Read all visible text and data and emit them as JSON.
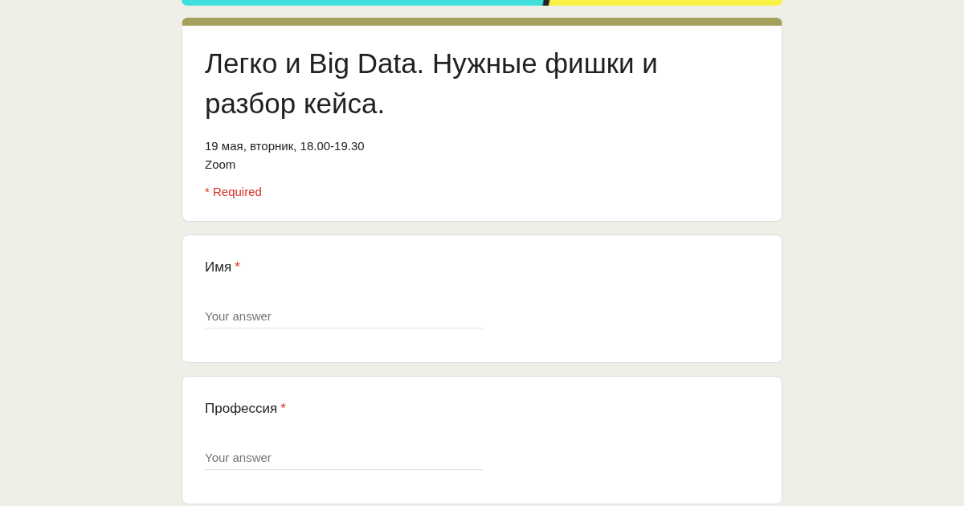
{
  "form": {
    "title": "Легко и Big Data. Нужные фишки и разбор кейса.",
    "description": [
      "19 мая, вторник, 18.00-19.30",
      "Zoom"
    ],
    "required_note": "* Required"
  },
  "questions": [
    {
      "label": "Имя",
      "required_mark": "*",
      "placeholder": "Your answer"
    },
    {
      "label": "Профессия",
      "required_mark": "*",
      "placeholder": "Your answer"
    }
  ]
}
